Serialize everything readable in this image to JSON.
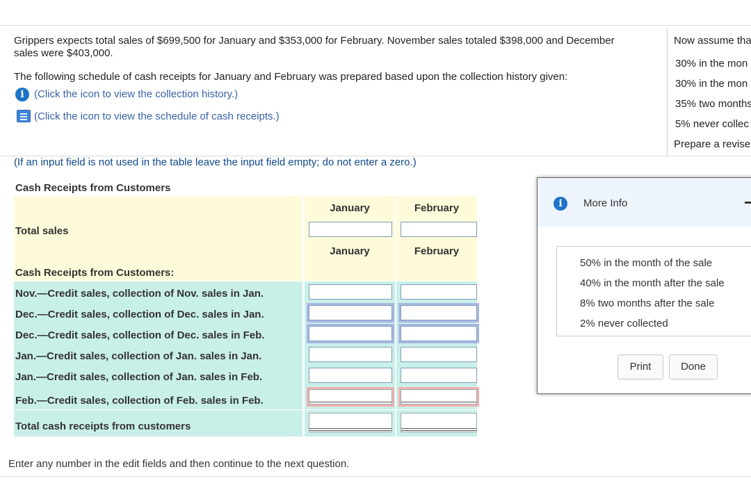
{
  "problem": {
    "line1": "Grippers expects total sales of $699,500 for January and $353,000 for February. November sales totaled $398,000 and December",
    "line2": "sales were $403,000.",
    "line3": "The following schedule of cash receipts for January and February was prepared based upon the collection history given:",
    "collection_link": "(Click the icon to view the collection history.)",
    "schedule_link": "(Click the icon to view the schedule of cash receipts.)",
    "note": "(If an input field is not used in the table leave the input field empty; do not enter a zero.)"
  },
  "right_panel": {
    "heading": "Now assume tha",
    "items": [
      "30% in the mon",
      "30% in the mon",
      "35% two months",
      "5% never collec"
    ],
    "footer": "Prepare a revise"
  },
  "table": {
    "title": "Cash Receipts from Customers",
    "col1": "January",
    "col2": "February",
    "total_sales_label": "Total sales",
    "section_label": "Cash Receipts from Customers:",
    "rows": [
      "Nov.—Credit sales, collection of Nov. sales in Jan.",
      "Dec.—Credit sales, collection of Dec. sales in Jan.",
      "Dec.—Credit sales, collection of Dec. sales in Feb.",
      "Jan.—Credit sales, collection of Jan. sales in Jan.",
      "Jan.—Credit sales, collection of Jan. sales in Feb.",
      "Feb.—Credit sales, collection of Feb. sales in Feb."
    ],
    "total_label": "Total cash receipts from customers"
  },
  "popup": {
    "title": "More Info",
    "items": [
      "50% in the month of the sale",
      "40% in the month after the sale",
      "8% two months after the sale",
      "2% never collected"
    ],
    "print_label": "Print",
    "done_label": "Done"
  },
  "footer_text": "Enter any number in the edit fields and then continue to the next question.",
  "colors": {
    "accent": "#1e73c8",
    "yellow": "#fdfbd9",
    "teal": "#c9efe9"
  }
}
